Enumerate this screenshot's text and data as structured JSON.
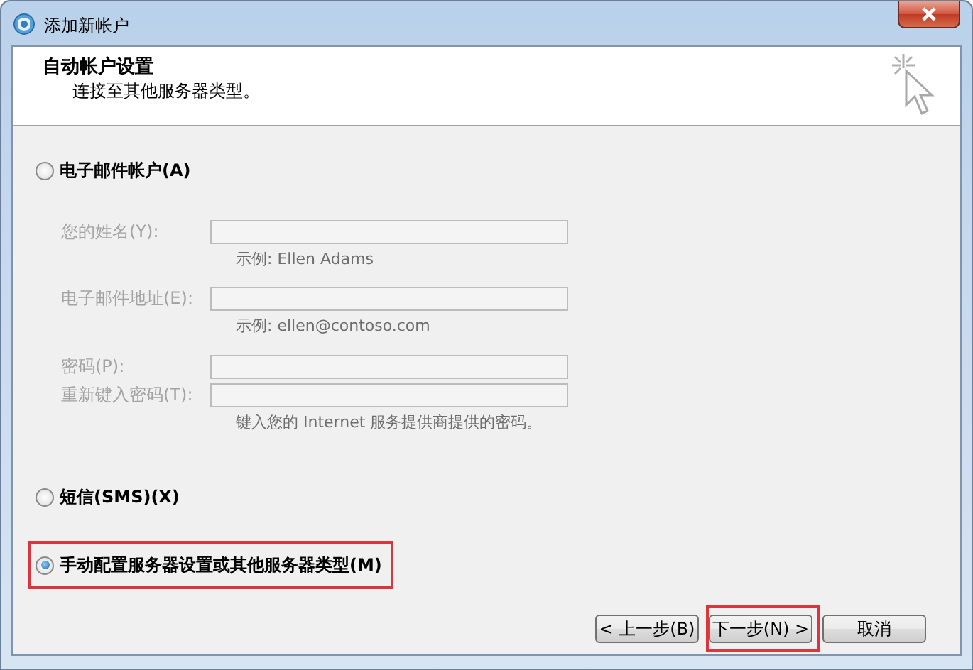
{
  "window": {
    "title": "添加新帐户"
  },
  "header": {
    "title": "自动帐户设置",
    "subtitle": "连接至其他服务器类型。"
  },
  "options": [
    {
      "label": "电子邮件帐户(A)",
      "selected": false,
      "highlighted": false,
      "fields": [
        {
          "label": "您的姓名(Y):",
          "hint": "示例: Ellen Adams",
          "disabled": true
        },
        {
          "label": "电子邮件地址(E):",
          "hint": "示例: ellen@contoso.com",
          "disabled": true
        },
        {
          "label": "密码(P):",
          "disabled": true
        },
        {
          "label": "重新键入密码(T):",
          "hint": "键入您的 Internet 服务提供商提供的密码。",
          "disabled": true
        }
      ]
    },
    {
      "label": "短信(SMS)(X)",
      "selected": false,
      "highlighted": false
    },
    {
      "label": "手动配置服务器设置或其他服务器类型(M)",
      "selected": true,
      "highlighted": true
    }
  ],
  "buttons": [
    {
      "label": "< 上一步(B)",
      "highlighted": false
    },
    {
      "label": "下一步(N) >",
      "highlighted": true
    },
    {
      "label": "取消",
      "highlighted": false
    }
  ]
}
